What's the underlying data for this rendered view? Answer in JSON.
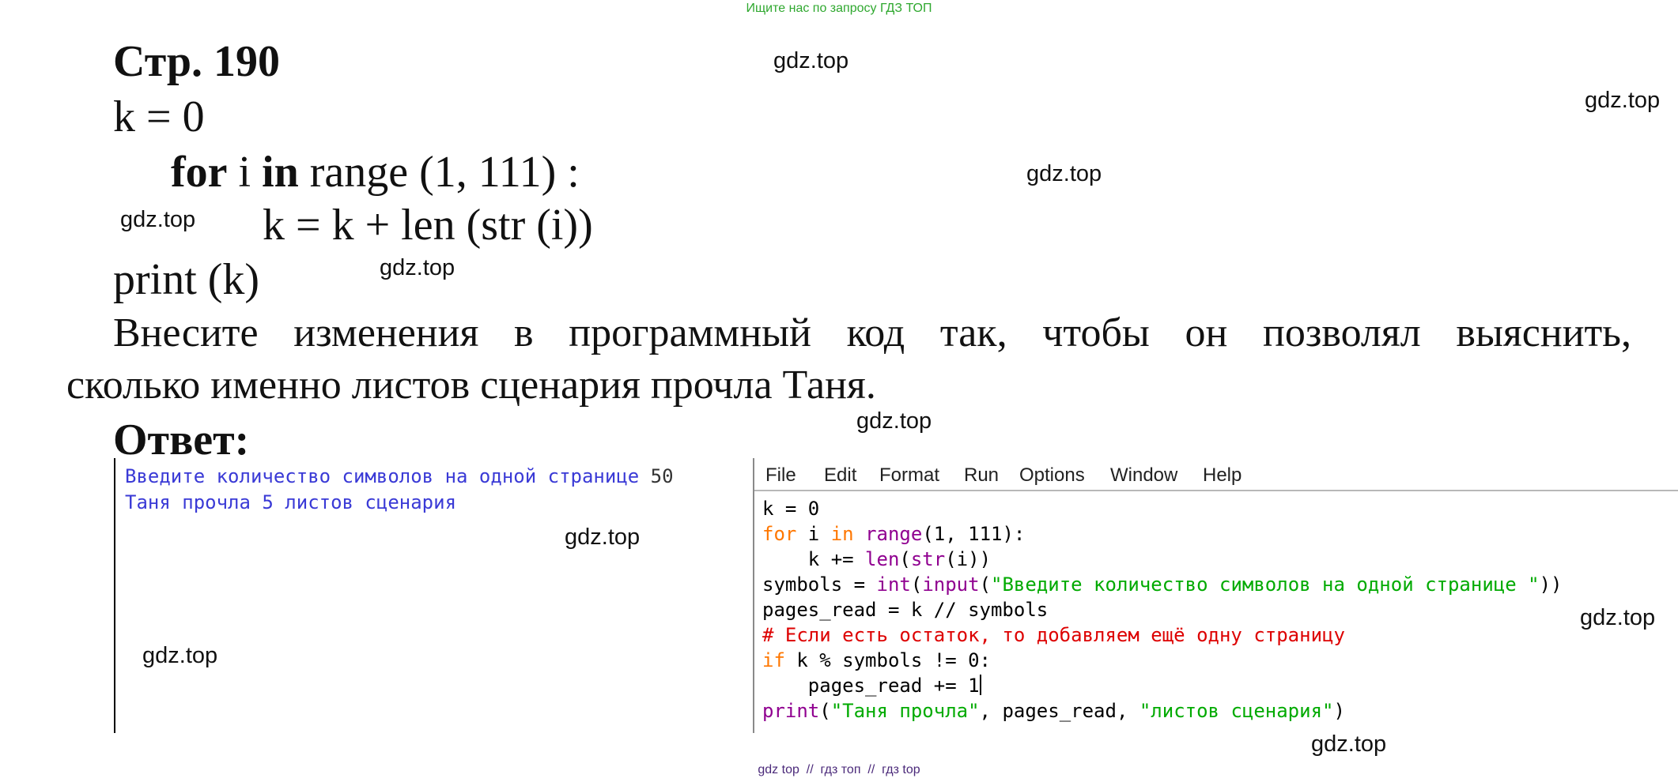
{
  "top_note": "Ищите нас по запросу ГДЗ ТОП",
  "page_heading": "Стр. 190",
  "code": {
    "line1": "k = 0",
    "line2_for": "for",
    "line2_mid": " i ",
    "line2_in": "in",
    "line2_rest": " range (1, 111) :",
    "line3": "k = k + len (str (i))",
    "line4": "print (k)"
  },
  "task": {
    "line1": "Внесите изменения в программный код так, чтобы он позволял выяснить,",
    "line2": "сколько именно листов сценария прочла Таня."
  },
  "answer_heading": "Ответ:",
  "shell": {
    "prompt": "Введите количество символов на одной странице ",
    "input_value": "50",
    "result": "Таня прочла 5 листов сценария"
  },
  "editor": {
    "menu": [
      "File",
      "Edit",
      "Format",
      "Run",
      "Options",
      "Window",
      "Help"
    ],
    "l1": "k = 0",
    "l2_kw1": "for",
    "l2_a": " i ",
    "l2_kw2": "in",
    "l2_b": " ",
    "l2_bi": "range",
    "l2_c": "(1, 111):",
    "l3_a": "    k += ",
    "l3_bi1": "len",
    "l3_b": "(",
    "l3_bi2": "str",
    "l3_c": "(i))",
    "l4_a": "symbols = ",
    "l4_bi1": "int",
    "l4_b": "(",
    "l4_bi2": "input",
    "l4_c": "(",
    "l4_str": "\"Введите количество символов на одной странице \"",
    "l4_d": "))",
    "l5": "pages_read = k // symbols",
    "l6_comment": "# Если есть остаток, то добавляем ещё одну страницу",
    "l7_kw": "if",
    "l7_rest": " k % symbols != 0:",
    "l8": "    pages_read += 1",
    "l9_bi": "print",
    "l9_a": "(",
    "l9_str1": "\"Таня прочла\"",
    "l9_b": ", pages_read, ",
    "l9_str2": "\"листов сценария\"",
    "l9_c": ")"
  },
  "watermark": "gdz.top",
  "bottom_note": "gdz top  //  гдз топ  //  гдз top"
}
